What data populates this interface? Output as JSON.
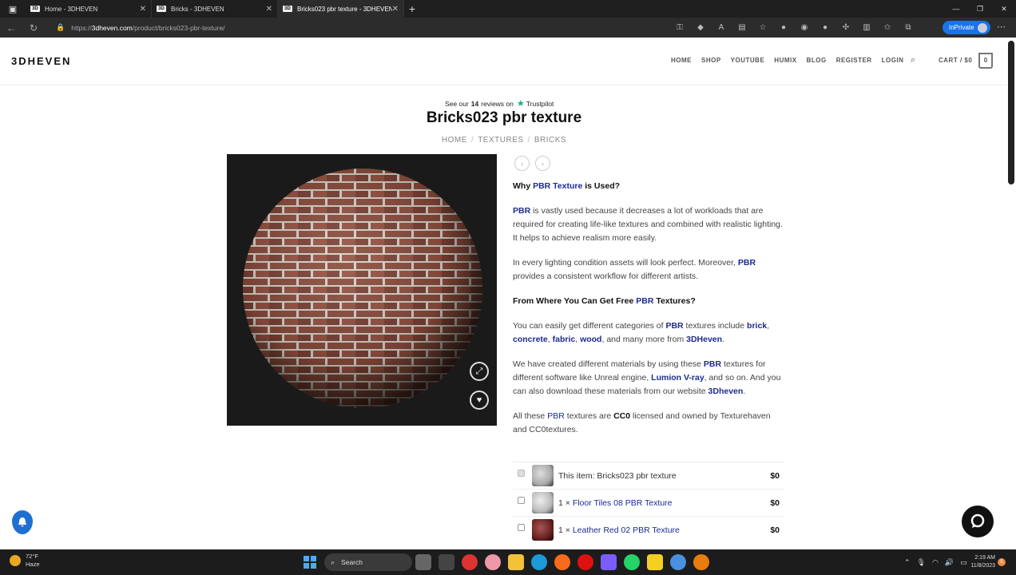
{
  "browser": {
    "tabs": [
      {
        "label": "Home - 3DHEVEN",
        "favicon": "3D"
      },
      {
        "label": "Bricks - 3DHEVEN",
        "favicon": "3D"
      },
      {
        "label": "Bricks023 pbr texture - 3DHEVEN",
        "favicon": "3D"
      }
    ],
    "url_prefix": "https://",
    "url_host": "3dheven.com",
    "url_path": "/product/bricks023-pbr-texture/",
    "inprivate_label": "InPrivate"
  },
  "site": {
    "logo": "3DHEVEN",
    "nav": [
      "HOME",
      "SHOP",
      "YOUTUBE",
      "HUMIX",
      "BLOG",
      "REGISTER",
      "LOGIN"
    ],
    "cart_label": "CART / $0",
    "cart_count": "0"
  },
  "trustpilot": {
    "pre": "See our",
    "count": "14",
    "post": "reviews on",
    "brand": "Trustpilot"
  },
  "product": {
    "title": "Bricks023 pbr texture",
    "breadcrumb": [
      "HOME",
      "TEXTURES",
      "BRICKS"
    ]
  },
  "description": {
    "h1_pre": "Why ",
    "h1_link": "PBR Texture",
    "h1_post": " is Used?",
    "p1_link": "PBR",
    "p1_text": " is vastly used because it decreases a lot of workloads that are required for creating life-like textures and combined with realistic lighting. It helps to achieve realism more easily.",
    "p2_a": "In every lighting condition assets will look perfect. Moreover, ",
    "p2_link": "PBR",
    "p2_b": " provides a consistent workflow for different artists.",
    "h2_pre": "From Where You Can Get Free ",
    "h2_link": "PBR",
    "h2_post": " Textures?",
    "p3_a": "You can easily get different categories of ",
    "p3_link1": "PBR",
    "p3_b": " textures include ",
    "p3_link2": "brick",
    "p3_c": ", ",
    "p3_link3": "concrete",
    "p3_d": ", ",
    "p3_link4": "fabric",
    "p3_e": ", ",
    "p3_link5": "wood",
    "p3_f": ", and many more from ",
    "p3_link6": "3DHeven",
    "p3_g": ".",
    "p4_a": "We have created different materials by using these ",
    "p4_link1": "PBR",
    "p4_b": " textures for different software like Unreal engine, ",
    "p4_link2": "Lumion V-ray",
    "p4_c": ", and so on. And you can also download these materials from our website ",
    "p4_link3": "3Dheven",
    "p4_d": ".",
    "p5_a": "All these ",
    "p5_link": "PBR",
    "p5_b": " textures are ",
    "p5_bold": "CC0",
    "p5_c": " licensed and owned by Texturehaven and CC0textures."
  },
  "bundle": [
    {
      "label": "This item: Bricks023 pbr texture",
      "price": "$0",
      "checked": true,
      "link": false
    },
    {
      "label": "1 × ",
      "link_text": "Floor Tiles 08 PBR Texture",
      "price": "$0",
      "checked": false,
      "link": true
    },
    {
      "label": "1 × ",
      "link_text": "Leather Red 02 PBR Texture",
      "price": "$0",
      "checked": false,
      "link": true
    }
  ],
  "taskbar": {
    "weather_temp": "72°F",
    "weather_desc": "Haze",
    "search_label": "Search",
    "time": "2:19 AM",
    "date": "11/8/2023",
    "notif_count": "5"
  },
  "colors": {
    "link": "#1c2b8f",
    "accent_tp": "#00b67a",
    "inprivate": "#1a73e8"
  }
}
